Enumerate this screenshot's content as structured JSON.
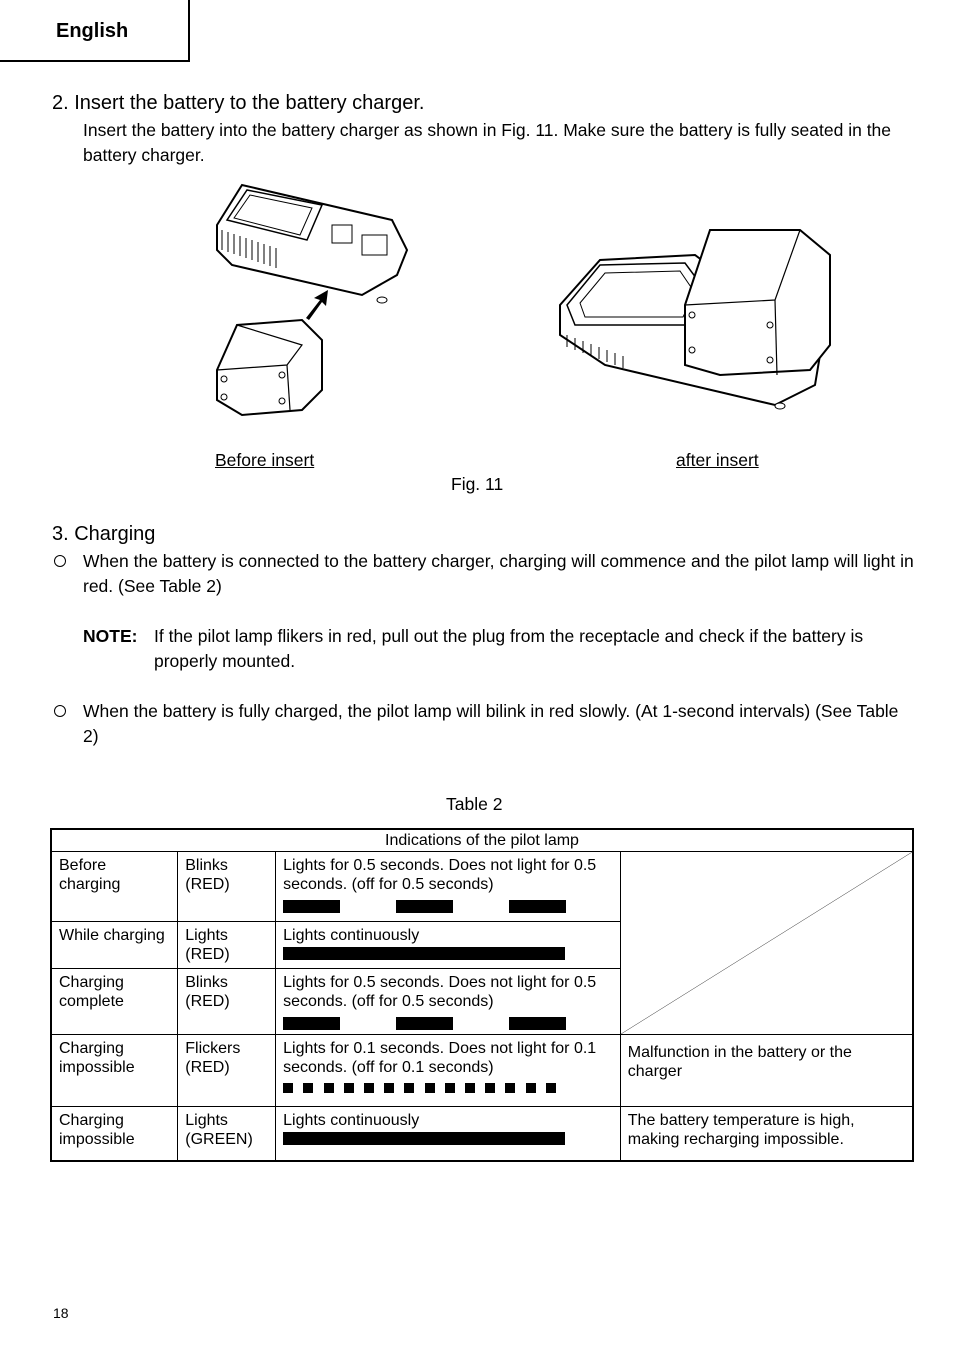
{
  "header": {
    "language_tab": "English"
  },
  "step2": {
    "title": "2.  Insert the battery to the battery charger.",
    "body": "Insert the battery into the battery charger as shown in Fig. 11. Make sure the battery is fully seated in the battery charger."
  },
  "figure": {
    "before_label": "Before insert",
    "after_label": "after insert",
    "caption": "Fig. 11"
  },
  "step3": {
    "title": "3.  Charging",
    "bullet1": "When the battery is connected to the battery charger, charging will commence and the pilot lamp will light in red. (See Table 2)",
    "note_label": "NOTE:",
    "note_text": "If the pilot lamp flikers in red, pull out the plug from the receptacle and check if the battery is properly mounted.",
    "bullet2": "When the battery is fully charged, the pilot lamp will bilink in red slowly. (At 1-second intervals) (See Table 2)"
  },
  "table2": {
    "caption": "Table 2",
    "header": "Indications of the pilot lamp",
    "rows": [
      {
        "state": "Before charging",
        "lamp": "Blinks (RED)",
        "desc": "Lights for 0.5 seconds. Does not light for 0.5 seconds. (off for 0.5 seconds)",
        "pattern": "blink",
        "note": ""
      },
      {
        "state": "While charging",
        "lamp": "Lights (RED)",
        "desc": "Lights continuously",
        "pattern": "continuous",
        "note": ""
      },
      {
        "state": "Charging complete",
        "lamp": "Blinks (RED)",
        "desc": "Lights for 0.5 seconds. Does not light for 0.5 seconds. (off for 0.5 seconds)",
        "pattern": "blink",
        "note": ""
      },
      {
        "state": "Charging impossible",
        "lamp": "Flickers (RED)",
        "desc": "Lights for 0.1 seconds. Does not light for 0.1 seconds. (off for 0.1 seconds)",
        "pattern": "flicker",
        "note": "Malfunction in the battery or the charger"
      },
      {
        "state": "Charging impossible",
        "lamp": "Lights (GREEN)",
        "desc": "Lights continuously",
        "pattern": "continuous",
        "note": "The battery temperature is high, making recharging impossible."
      }
    ]
  },
  "footer": {
    "page_number": "18"
  }
}
